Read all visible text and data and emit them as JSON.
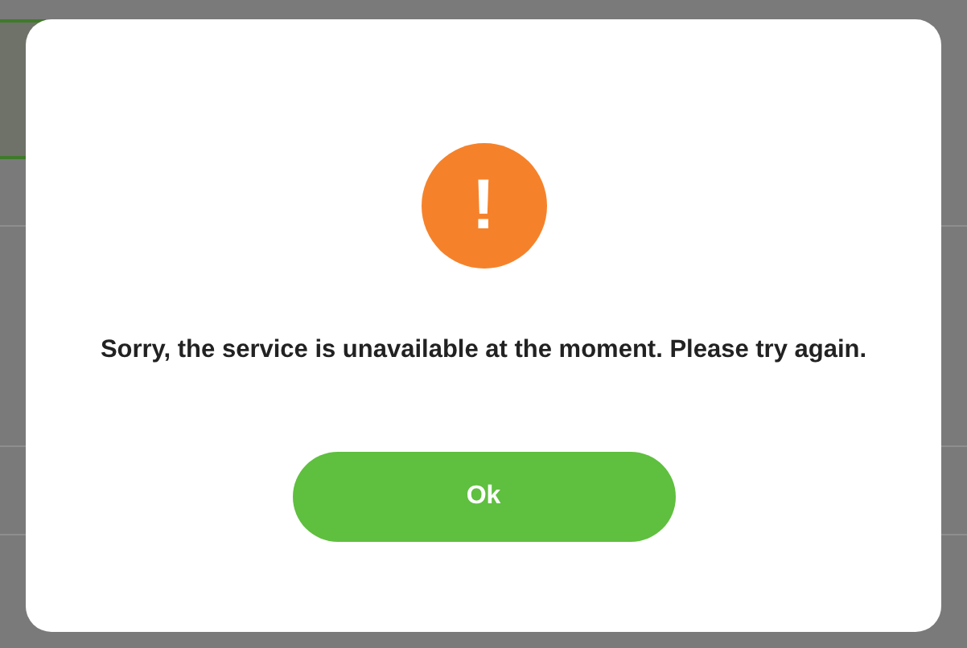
{
  "dialog": {
    "icon": "!",
    "message": "Sorry, the service is unavailable at the moment. Please try again.",
    "buttons": [
      {
        "label": "Ok"
      }
    ]
  }
}
